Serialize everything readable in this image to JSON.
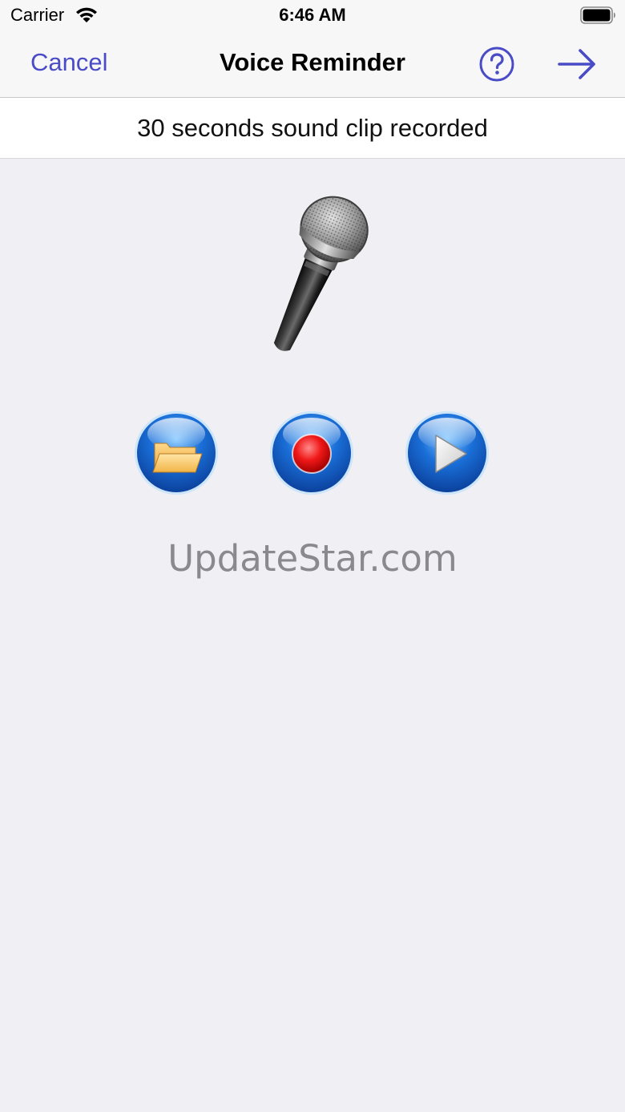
{
  "status_bar": {
    "carrier": "Carrier",
    "time": "6:46 AM",
    "wifi_icon": "wifi-icon",
    "battery_icon": "battery-full-icon"
  },
  "nav": {
    "cancel_label": "Cancel",
    "title": "Voice Reminder",
    "help_icon": "question-circle-icon",
    "forward_icon": "arrow-right-icon",
    "accent_color": "#4a4bc6"
  },
  "recording": {
    "status_message": "30 seconds sound clip recorded",
    "microphone_icon": "microphone-icon",
    "buttons": [
      {
        "name": "open",
        "icon": "folder-icon"
      },
      {
        "name": "record",
        "icon": "record-icon"
      },
      {
        "name": "play",
        "icon": "play-icon"
      }
    ]
  },
  "watermark": "UpdateStar.com"
}
